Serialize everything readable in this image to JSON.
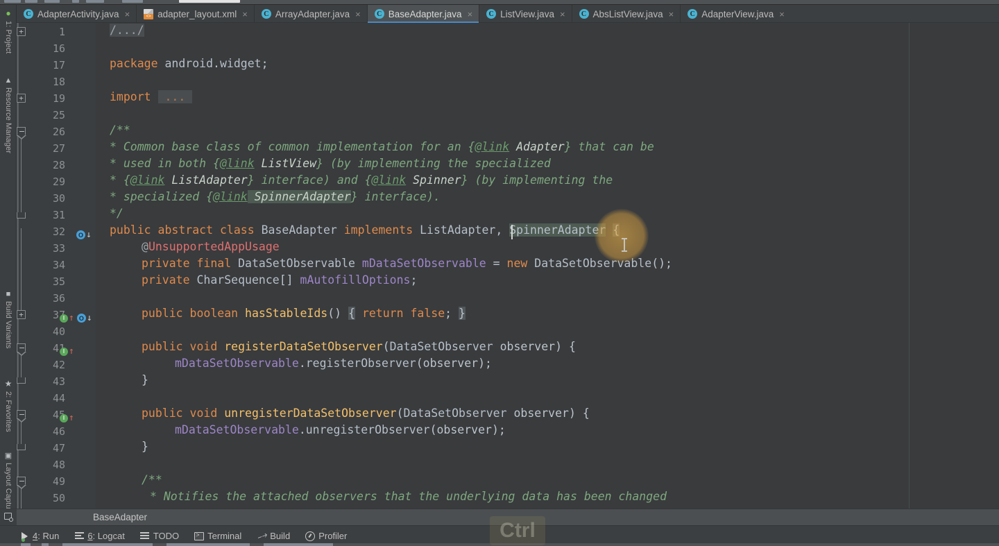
{
  "window": {
    "title": "BaseAdapter.java",
    "accent_color": "#4a88c7",
    "editor_bg": "#393b3d",
    "chrome_bg": "#3c3f41"
  },
  "tool_stripe": {
    "items": [
      {
        "label": "1: Project",
        "icon": "project-icon"
      },
      {
        "label": "Resource Manager",
        "icon": "resource-manager-icon"
      },
      {
        "label": "Build Variants",
        "icon": "build-variants-icon"
      },
      {
        "label": "2: Favorites",
        "icon": "star-icon"
      },
      {
        "label": "Layout Captures",
        "icon": "layout-captures-icon"
      }
    ]
  },
  "tabs": [
    {
      "label": "AdapterActivity.java",
      "icon": "java-class-icon",
      "active": false,
      "close": "×"
    },
    {
      "label": "adapter_layout.xml",
      "icon": "xml-layout-icon",
      "active": false,
      "close": "×"
    },
    {
      "label": "ArrayAdapter.java",
      "icon": "java-class-icon",
      "active": false,
      "close": "×"
    },
    {
      "label": "BaseAdapter.java",
      "icon": "java-class-icon",
      "active": true,
      "close": "×"
    },
    {
      "label": "ListView.java",
      "icon": "java-class-icon",
      "active": false,
      "close": "×"
    },
    {
      "label": "AbsListView.java",
      "icon": "java-class-icon",
      "active": false,
      "close": "×"
    },
    {
      "label": "AdapterView.java",
      "icon": "java-class-icon",
      "active": false,
      "close": "×"
    }
  ],
  "editor": {
    "line_numbers": [
      "1",
      "16",
      "17",
      "18",
      "19",
      "25",
      "26",
      "27",
      "28",
      "29",
      "30",
      "31",
      "32",
      "33",
      "34",
      "35",
      "36",
      "37",
      "40",
      "41",
      "42",
      "43",
      "44",
      "45",
      "46",
      "47",
      "48",
      "49",
      "50"
    ],
    "lines": [
      {
        "num": "1",
        "text": "/.../"
      },
      {
        "num": "16",
        "text": ""
      },
      {
        "num": "17",
        "text": "package android.widget;"
      },
      {
        "num": "18",
        "text": ""
      },
      {
        "num": "19",
        "text": "import ..."
      },
      {
        "num": "25",
        "text": ""
      },
      {
        "num": "26",
        "text": "/**"
      },
      {
        "num": "27",
        "text": " * Common base class of common implementation for an {@link Adapter} that can be"
      },
      {
        "num": "28",
        "text": " * used in both {@link ListView} (by implementing the specialized"
      },
      {
        "num": "29",
        "text": " * {@link ListAdapter} interface) and {@link Spinner} (by implementing the"
      },
      {
        "num": "30",
        "text": " * specialized {@link SpinnerAdapter} interface)."
      },
      {
        "num": "31",
        "text": " */"
      },
      {
        "num": "32",
        "text": "public abstract class BaseAdapter implements ListAdapter, SpinnerAdapter {"
      },
      {
        "num": "33",
        "text": "    @UnsupportedAppUsage"
      },
      {
        "num": "34",
        "text": "    private final DataSetObservable mDataSetObservable = new DataSetObservable();"
      },
      {
        "num": "35",
        "text": "    private CharSequence[] mAutofillOptions;"
      },
      {
        "num": "36",
        "text": ""
      },
      {
        "num": "37",
        "text": "    public boolean hasStableIds() { return false; }"
      },
      {
        "num": "40",
        "text": ""
      },
      {
        "num": "41",
        "text": "    public void registerDataSetObserver(DataSetObserver observer) {"
      },
      {
        "num": "42",
        "text": "        mDataSetObservable.registerObserver(observer);"
      },
      {
        "num": "43",
        "text": "    }"
      },
      {
        "num": "44",
        "text": ""
      },
      {
        "num": "45",
        "text": "    public void unregisterDataSetObserver(DataSetObserver observer) {"
      },
      {
        "num": "46",
        "text": "        mDataSetObservable.unregisterObserver(observer);"
      },
      {
        "num": "47",
        "text": "    }"
      },
      {
        "num": "48",
        "text": ""
      },
      {
        "num": "49",
        "text": "    /**"
      },
      {
        "num": "50",
        "text": "     * Notifies the attached observers that the underlying data has been changed"
      }
    ],
    "selected_identifier": "SpinnerAdapter",
    "caret_line": "32",
    "gutter_markers": [
      {
        "line": "32",
        "icons": [
          "overriding-method-icon",
          "arrow-down-icon"
        ]
      },
      {
        "line": "37",
        "icons": [
          "implementing-method-icon",
          "arrow-up-icon",
          "overriding-method-icon",
          "arrow-down-icon"
        ]
      },
      {
        "line": "41",
        "icons": [
          "implementing-method-icon",
          "arrow-up-icon"
        ]
      },
      {
        "line": "45",
        "icons": [
          "implementing-method-icon",
          "arrow-up-icon"
        ]
      }
    ]
  },
  "breadcrumb": {
    "icon": "file-structure-icon",
    "text": "BaseAdapter"
  },
  "bottom_toolbar": {
    "items": [
      {
        "label": "4: Run",
        "mnemonic": "4",
        "rest": ": Run",
        "icon": "run-icon"
      },
      {
        "label": "6: Logcat",
        "mnemonic": "6",
        "rest": ": Logcat",
        "icon": "logcat-icon"
      },
      {
        "label": "TODO",
        "mnemonic": "",
        "rest": "TODO",
        "icon": "todo-icon"
      },
      {
        "label": "Terminal",
        "mnemonic": "",
        "rest": "Terminal",
        "icon": "terminal-icon"
      },
      {
        "label": "Build",
        "mnemonic": "",
        "rest": "Build",
        "icon": "build-hammer-icon"
      },
      {
        "label": "Profiler",
        "mnemonic": "",
        "rest": "Profiler",
        "icon": "profiler-icon"
      }
    ]
  },
  "keycast": {
    "key": "Ctrl"
  }
}
